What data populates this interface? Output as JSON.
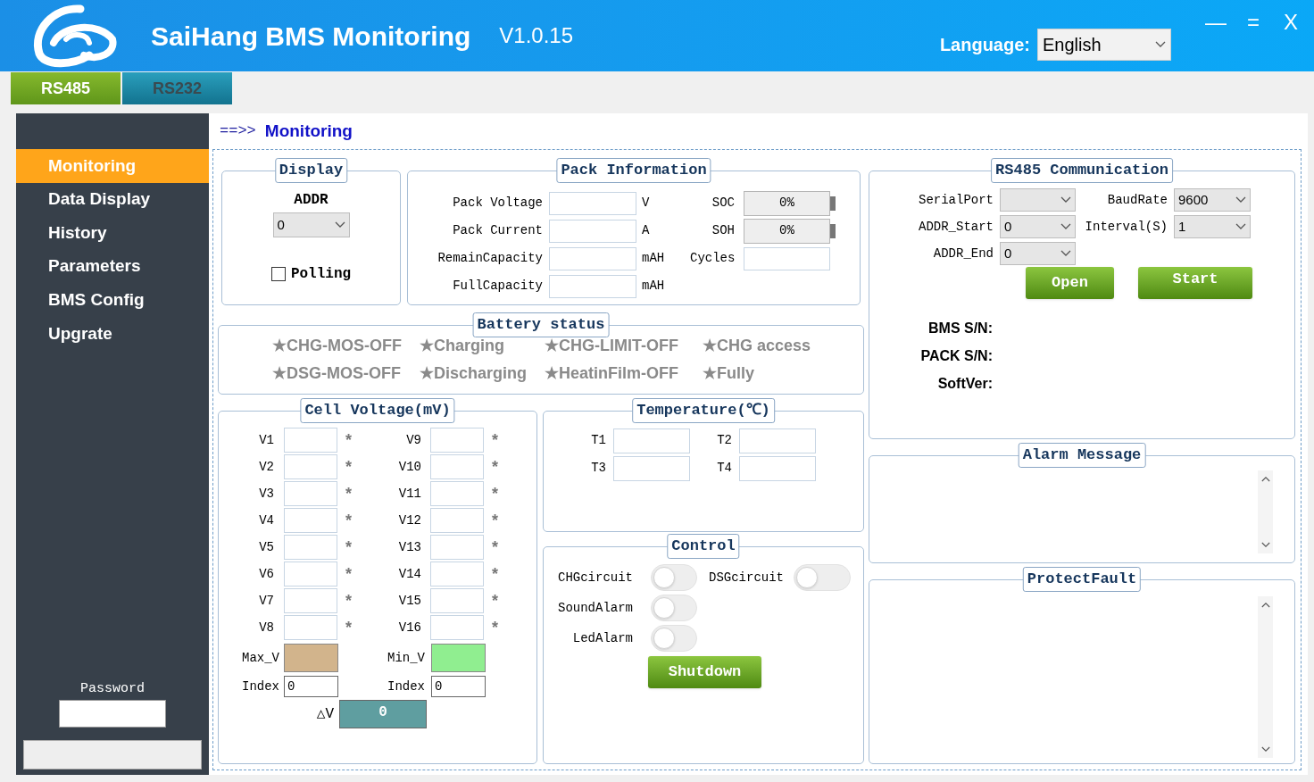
{
  "header": {
    "title": "SaiHang BMS Monitoring",
    "version": "V1.0.15",
    "language_label": "Language:",
    "language_value": "English",
    "window_controls": [
      "—",
      "=",
      "X"
    ]
  },
  "tabs": [
    {
      "label": "RS485",
      "selected": true
    },
    {
      "label": "RS232",
      "selected": false
    }
  ],
  "sidebar": {
    "items": [
      {
        "label": "Monitoring",
        "selected": true
      },
      {
        "label": "Data Display",
        "selected": false
      },
      {
        "label": "History",
        "selected": false
      },
      {
        "label": "Parameters",
        "selected": false
      },
      {
        "label": "BMS Config",
        "selected": false
      },
      {
        "label": "Upgrate",
        "selected": false
      }
    ],
    "password_label": "Password"
  },
  "breadcrumb": {
    "arrow": "==>>",
    "title": "Monitoring"
  },
  "display": {
    "title": "Display",
    "addr_label": "ADDR",
    "addr_value": "0",
    "polling": {
      "label": "Polling",
      "checked": false
    }
  },
  "pack_info": {
    "title": "Pack Information",
    "rows": [
      {
        "label": "Pack Voltage",
        "unit": "V",
        "right": {
          "kind": "gauge",
          "label": "SOC",
          "value": "0%",
          "level": 0
        }
      },
      {
        "label": "Pack Current",
        "unit": "A",
        "right": {
          "kind": "gauge",
          "label": "SOH",
          "value": "0%",
          "level": 0
        }
      },
      {
        "label": "RemainCapacity",
        "unit": "mAH",
        "right": {
          "kind": "field",
          "label": "Cycles"
        }
      },
      {
        "label": "FullCapacity",
        "unit": "mAH"
      }
    ]
  },
  "battery_status": {
    "title": "Battery status",
    "items": [
      "★CHG-MOS-OFF",
      "★Charging",
      "★CHG-LIMIT-OFF",
      "★CHG access",
      "★DSG-MOS-OFF",
      "★Discharging",
      "★HeatinFilm-OFF",
      "★Fully"
    ]
  },
  "cell_voltage": {
    "title": "Cell Voltage(mV)",
    "rows": [
      {
        "left": "V1",
        "left_mark": "*",
        "right": "V9",
        "right_mark": "*"
      },
      {
        "left": "V2",
        "left_mark": "*",
        "right": "V10",
        "right_mark": "*"
      },
      {
        "left": "V3",
        "left_mark": "*",
        "right": "V11",
        "right_mark": "*"
      },
      {
        "left": "V4",
        "left_mark": "*",
        "right": "V12",
        "right_mark": "*"
      },
      {
        "left": "V5",
        "left_mark": "*",
        "right": "V13",
        "right_mark": "*"
      },
      {
        "left": "V6",
        "left_mark": "*",
        "right": "V14",
        "right_mark": "*"
      },
      {
        "left": "V7",
        "left_mark": "*",
        "right": "V15",
        "right_mark": "*"
      },
      {
        "left": "V8",
        "left_mark": "*",
        "right": "V16",
        "right_mark": "*"
      }
    ],
    "max_label": "Max_V",
    "min_label": "Min_V",
    "max_index_label": "Index",
    "max_index_value": "0",
    "min_index_label": "Index",
    "min_index_value": "0",
    "delta_label": "△V",
    "delta_value": "0"
  },
  "temperature": {
    "title": "Temperature(℃)",
    "sensors": [
      "T1",
      "T2",
      "T3",
      "T4"
    ]
  },
  "control": {
    "title": "Control",
    "switches": [
      {
        "label": "CHGcircuit",
        "on": false
      },
      {
        "label": "DSGcircuit",
        "on": false
      },
      {
        "label": "SoundAlarm",
        "on": false
      },
      {
        "label": "LedAlarm",
        "on": false
      }
    ],
    "shutdown": "Shutdown"
  },
  "rs485": {
    "title": "RS485 Communication",
    "serial_port_label": "SerialPort",
    "baud_label": "BaudRate",
    "baud_value": "9600",
    "addr_start_label": "ADDR_Start",
    "addr_start_value": "0",
    "interval_label": "Interval(S)",
    "interval_value": "1",
    "addr_end_label": "ADDR_End",
    "addr_end_value": "0",
    "open": "Open",
    "start": "Start",
    "info": [
      "BMS S/N:",
      "PACK S/N:",
      "SoftVer:"
    ]
  },
  "alarm_message": {
    "title": "Alarm Message"
  },
  "protect_fault": {
    "title": "ProtectFault"
  }
}
